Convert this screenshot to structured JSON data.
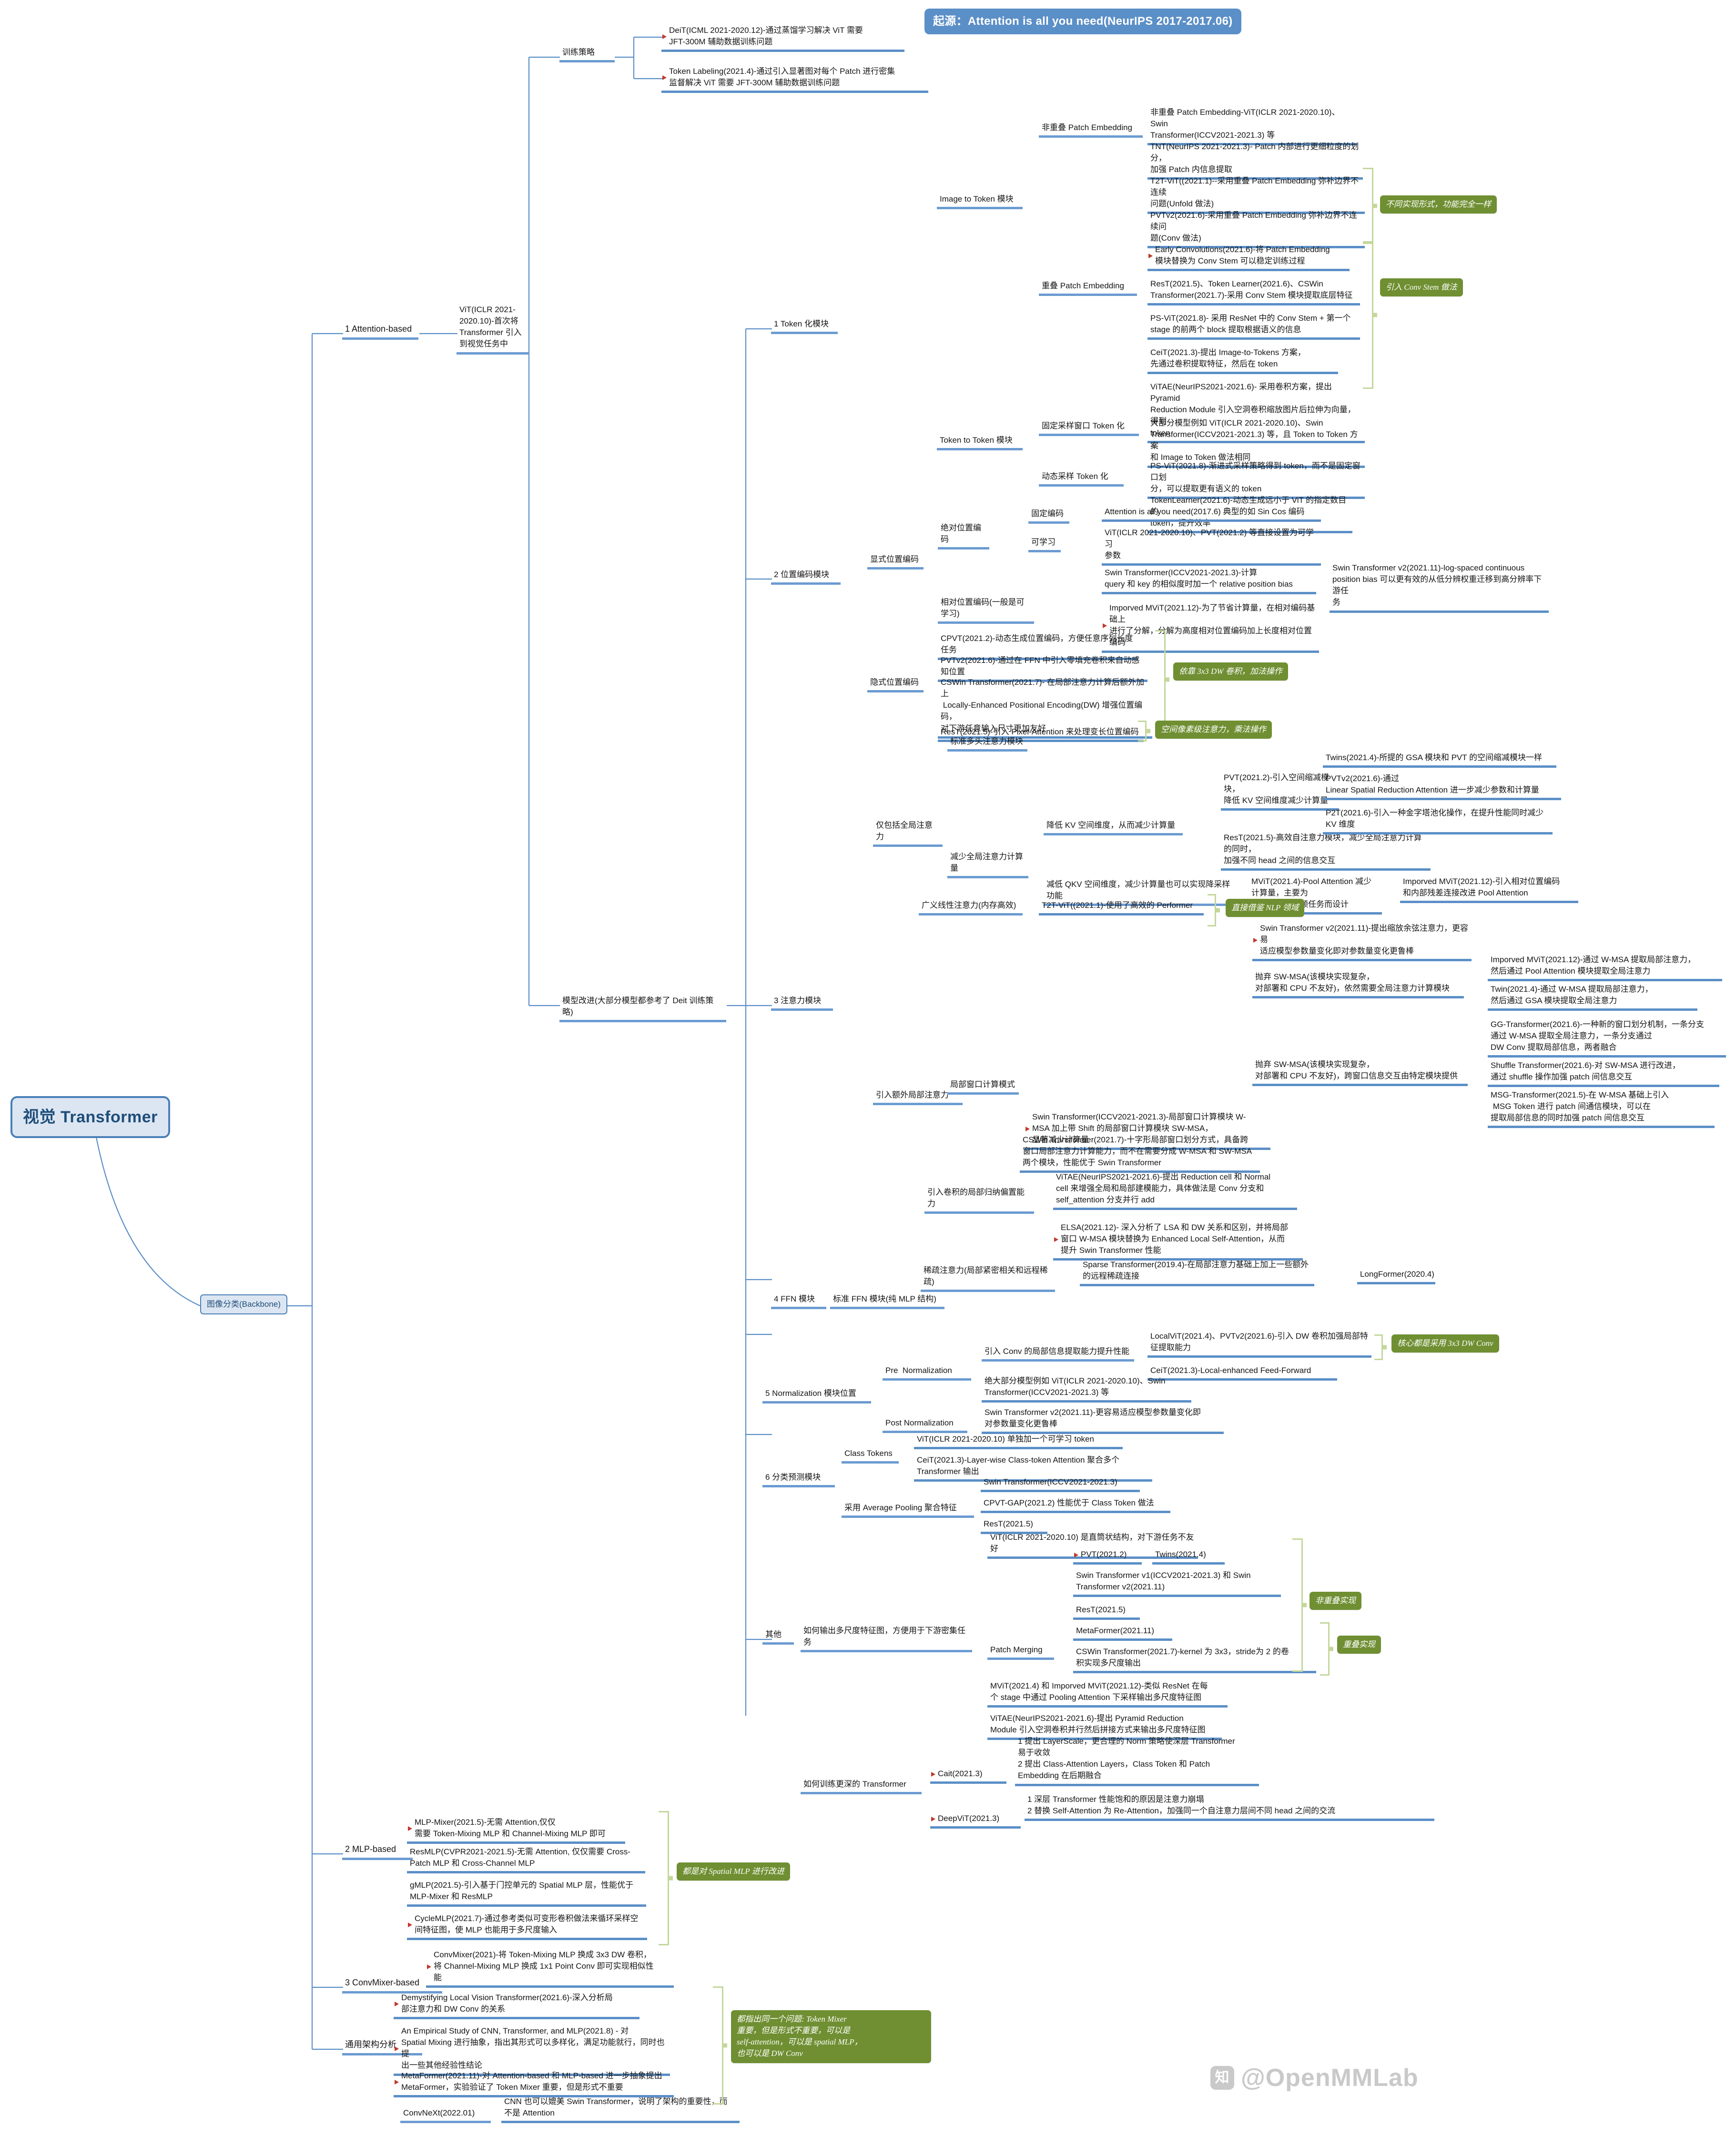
{
  "root": {
    "label": "视觉 Transformer"
  },
  "banner": {
    "label": "起源：Attention is all you need(NeurIPS 2017-2017.06)"
  },
  "watermark": {
    "label": "@OpenMMLab",
    "logo": "知"
  },
  "branches": {
    "attention_based": "1 Attention-based",
    "mlp_based": "2 MLP-based",
    "convmixer_based": "3 ConvMixer-based",
    "general_arch": "通用架构分析",
    "backbone_pill": "图像分类(Backbone)"
  },
  "attention": {
    "vit_origin": "ViT(ICLR 2021-2020.10)-首次将\nTransformer 引入\n到视觉任务中",
    "training_strategy": "训练策略",
    "training_items": [
      "DeiT(ICML 2021-2020.12)-通过蒸馏学习解决 ViT 需要\nJFT-300M 辅助数据训练问题",
      "Token Labeling(2021.4)-通过引入显著图对每个 Patch 进行密集\n监督解决 ViT 需要 JFT-300M 辅助数据训练问题"
    ],
    "model_improve": "模型改进(大部分模型都参考了 Deit 训练策略)"
  },
  "module1": {
    "label": "1 Token 化模块",
    "image_to_token": "Image to Token 模块",
    "token_to_token": "Token to Token 模块",
    "non_overlap": "非重叠 Patch Embedding",
    "overlap": "重叠 Patch Embedding",
    "non_overlap_items": [
      "非重叠 Patch Embedding-ViT(ICLR 2021-2020.10)、Swin\nTransformer(ICCV2021-2021.3) 等",
      "TNT(NeurIPS 2021-2021.3)- Patch 内部进行更细粒度的划分，\n加强 Patch 内信息提取"
    ],
    "overlap_items": [
      "T2T-ViT((2021.1)--采用重叠 Patch Embedding 弥补边界不连续\n问题(Unfold 做法)",
      "PVTv2(2021.6)-采用重叠 Patch Embedding 弥补边界不连续问\n题(Conv 做法)",
      "Early Convolutions(2021.6)-将 Patch Embedding\n模块替换为 Conv Stem 可以稳定训练过程",
      "ResT(2021.5)、Token Learner(2021.6)、CSWin\nTransformer(2021.7)-采用 Conv Stem 模块提取底层特征",
      "PS-ViT(2021.8)- 采用 ResNet 中的 Conv Stem + 第一个\nstage 的前两个 block 提取根据语义的信息",
      "CeiT(2021.3)-提出 Image-to-Tokens 方案，\n先通过卷积提取特征，然后在 token",
      "ViTAE(NeurIPS2021-2021.6)- 采用卷积方案，提出 Pyramid\nReduction Module 引入空洞卷积缩放图片后拉伸为向量，得到\ntoken"
    ],
    "fixed_window": "固定采样窗口 Token 化",
    "dynamic_sample": "动态采样 Token 化",
    "fixed_window_items": [
      "大部分模型例如 ViT(ICLR 2021-2020.10)、Swin\nTransformer(ICCV2021-2021.3) 等，且 Token to Token 方案\n和 Image to Token 做法相同"
    ],
    "dynamic_items": [
      "PS-ViT(2021.8)-渐进式采样策略得到 token，而不是固定窗口划\n分，可以提取更有语义的 token",
      "TokenLearner(2021.6)-动态生成远小于 ViT 的指定数目的\ntoken，提升效率"
    ],
    "callouts": [
      "不同实现形式，功能完全一样",
      "引入 Conv Stem 做法"
    ]
  },
  "module2": {
    "label": "2 位置编码模块",
    "explicit": "显式位置编码",
    "implicit": "隐式位置编码",
    "absolute": "绝对位置编码",
    "relative": "相对位置编码(一般是可学习)",
    "fixed_encoding": "固定编码",
    "learnable": "可学习",
    "fixed_items": [
      "Attention is all you need(2017.6) 典型的如 Sin Cos 编码"
    ],
    "learnable_items": [
      "ViT(ICLR 2021-2020.10)、PVT(2021.2) 等直接设置为可学习\n参数"
    ],
    "relative_items": [
      "Swin Transformer(ICCV2021-2021.3)-计算\nquery 和 key 的相似度时加一个 relative position bias",
      "Imporved MViT(2021.12)-为了节省计算量，在相对编码基础上\n进行了分解，分解为高度相对位置编码加上长度相对位置编码"
    ],
    "relative_sub": "Swin Transformer v2(2021.11)-log-spaced continuous\nposition bias 可以更有效的从低分辨权重迁移到高分辨率下游任\n务",
    "implicit_items": [
      "CPVT(2021.2)-动态生成位置编码，方便任意序列长度任务",
      "PVTv2(2021.6)-通过在 FFN 中引入零填充卷积来自动感知位置",
      "CSWin Transformer(2021.7)- 在局部注意力计算后额外加上\n Locally-Enhanced Positional Encoding(DW) 增强位置编码，\n对下游任意输入尺寸更加友好",
      "ResT(2021.5)-引入 Pixel-Attention 来处理变长位置编码"
    ],
    "callouts": [
      "依靠 3x3 DW 卷积，加法操作",
      "空间像素级注意力，乘法操作"
    ]
  },
  "module3": {
    "label": "3 注意力模块",
    "global_only": "仅包括全局注意力",
    "standard_mhsa": "标准多头注意力模块",
    "reduce_global": "减少全局注意力计算量",
    "reduce_kv": "降低 KV 空间维度，从而减少计算量",
    "reduce_qkv": "减低 QKV 空间维度，减少计算量也可以实现降采样功能",
    "linear_attention": "广义线性注意力(内存高效)",
    "reduce_kv_items": [
      "PVT(2021.2)-引入空间缩减模块，\n降低 KV 空间维度减少计算量",
      "ResT(2021.5)-高效自注意力模块，减少全局注意力计算的同时，\n加强不同 head 之间的信息交互"
    ],
    "reduce_kv_sub": [
      "Twins(2021.4)-所提的 GSA 模块和 PVT 的空间缩减模块一样",
      "PVTv2(2021.6)-通过\nLinear Spatial Reduction Attention 进一步减少参数和计算量",
      "P2T(2021.6)-引入一种金字塔池化操作，在提升性能同时减少\nKV 维度"
    ],
    "reduce_qkv_items": [
      "MViT(2021.4)-Pool Attention 减少计算量，主要为\n图像分类和视频任务而设计",
      "Imporved MViT(2021.12)-引入相对位置编码\n和内部残差连接改进 Pool Attention"
    ],
    "linear_items": [
      "T2T-ViT((2021.1)-使用了高效的 Performer"
    ],
    "local_window": "引入额外局部注意力",
    "local_window_mode": "局部窗口计算模式",
    "swin_main": "Swin Transformer(ICCV2021-2021.3)-局部窗口计算模块 W-\nMSA 加上带 Shift 的局部窗口计算模块 SW-MSA，\n显著减少计算量",
    "swin_v2": "Swin Transformer v2(2021.11)-提出缩放余弦注意力，更容易\n适应模型参数量变化即对参数量变化更鲁棒",
    "drop_swmsa_1": "抛弃 SW-MSA(该模块实现复杂，\n对部署和 CPU 不友好)，依然需要全局注意力计算模块",
    "drop_swmsa_2": "抛弃 SW-MSA(该模块实现复杂，\n对部署和 CPU 不友好)，跨窗口信息交互由特定模块提供",
    "drop1_items": [
      "Imporved MViT(2021.12)-通过 W-MSA 提取局部注意力，\n然后通过 Pool Attention 模块提取全局注意力",
      "Twin(2021.4)-通过 W-MSA 提取局部注意力，\n然后通过 GSA 模块提取全局注意力"
    ],
    "drop2_items": [
      "GG-Transformer(2021.6)-一种新的窗口划分机制，一条分支\n通过 W-MSA 提取全局注意力，一条分支通过\nDW Conv 提取局部信息，两者融合",
      "Shuffle Transformer(2021.6)-对 SW-MSA 进行改进，\n通过 shuffle 操作加强 patch 间信息交互",
      "MSG-Transformer(2021.5)-在 W-MSA 基础上引入\n MSG Token 进行 patch 间通信模块，可以在\n提取局部信息的同时加强 patch 间信息交互"
    ],
    "cswin_item": "CSWin Transformer(2021.7)-十字形局部窗口划分方式，具备跨\n窗口局部注意力计算能力，而不在需要分成 W-MSA 和 SW-MSA\n两个模块，性能优于 Swin Transformer",
    "conv_bias": "引入卷积的局部归纳偏置能力",
    "conv_bias_items": [
      "ViTAE(NeurIPS2021-2021.6)-提出 Reduction cell 和 Normal\ncell 来增强全局和局部建模能力，具体做法是 Conv 分支和\nself_attention 分支并行 add",
      "ELSA(2021.12)- 深入分析了 LSA 和 DW 关系和区别，并将局部\n窗口 W-MSA 模块替换为 Enhanced Local Self-Attention，从而\n提升 Swin Transformer 性能"
    ],
    "sparse": "稀疏注意力(局部紧密相关和远程稀疏)",
    "sparse_items": [
      "Sparse Transformer(2019.4)-在局部注意力基础上加上一些额外\n的远程稀疏连接",
      "LongFormer(2020.4)"
    ],
    "callouts": [
      "直接借鉴 NLP 领域"
    ]
  },
  "module4": {
    "label": "4 FFN 模块",
    "standard": "标准 FFN 模块(纯 MLP 结构)"
  },
  "module5": {
    "label": "5 Normalization 模块位置",
    "pre_norm": "Pre  Normalization",
    "post_norm": "Post Normalization",
    "conv_local": "引入 Conv 的局部信息提取能力提升性能",
    "conv_local_items": [
      "LocalViT(2021.4)、PVTv2(2021.6)-引入 DW 卷积加强局部特\n征提取能力",
      "CeiT(2021.3)-Local-enhanced Feed-Forward"
    ],
    "pre_norm_items": [
      "绝大部分模型例如 ViT(ICLR 2021-2020.10)、Swin\nTransformer(ICCV2021-2021.3) 等"
    ],
    "post_norm_items": [
      "Swin Transformer v2(2021.11)-更容易适应模型参数量变化即\n对参数量变化更鲁棒"
    ],
    "callouts": [
      "核心都是采用 3x3 DW Conv"
    ]
  },
  "module6": {
    "label": "6 分类预测模块",
    "class_tokens": "Class Tokens",
    "avg_pooling": "采用 Average Pooling 聚合特征",
    "class_token_items": [
      "ViT(ICLR 2021-2020.10) 单独加一个可学习 token",
      "CeiT(2021.3)-Layer-wise Class-token Attention 聚合多个\nTransformer 输出"
    ],
    "avg_pooling_items": [
      "Swin Transformer(ICCV2021-2021.3)",
      "CPVT-GAP(2021.2) 性能优于 Class Token 做法",
      "ResT(2021.5)"
    ]
  },
  "others": {
    "label": "其他",
    "multiscale": "如何输出多尺度特征图，方便用于下游密集任务",
    "multiscale_head": "ViT(ICLR 2021-2020.10) 是直筒状结构，对下游任务不友好",
    "patch_merging": "Patch Merging",
    "patch_merging_items": [
      "PVT(2021.2)",
      "Twins(2021.4)",
      "Swin Transformer v1(ICCV2021-2021.3) 和 Swin\nTransformer v2(2021.11)",
      "ResT(2021.5)",
      "MetaFormer(2021.11)",
      "CSWin Transformer(2021.7)-kernel 为 3x3，stride为 2 的卷\n积实现多尺度输出"
    ],
    "multiscale_items": [
      "MViT(2021.4) 和 Imporved MViT(2021.12)-类似 ResNet 在每\n个 stage 中通过 Pooling Attention 下采样输出多尺度特征图",
      "ViTAE(NeurIPS2021-2021.6)-提出 Pyramid Reduction\nModule 引入空洞卷积并行然后拼接方式来输出多尺度特征图"
    ],
    "deeper": "如何训练更深的 Transformer",
    "cait": "Cait(2021.3)",
    "cait_text": "1 提出 LayerScale，更合理的 Norm 策略使深层 Transformer\n易于收敛\n2 提出 Class-Attention Layers，Class Token 和 Patch\nEmbedding 在后期融合",
    "deepvit": "DeepViT(2021.3)",
    "deepvit_text": "1 深层 Transformer 性能饱和的原因是注意力崩塌\n2 替换 Self-Attention 为 Re-Attention，加强同一个自注意力层间不同 head 之间的交流",
    "callouts": [
      "非重叠实现",
      "重叠实现"
    ]
  },
  "mlp_based": {
    "items": [
      "MLP-Mixer(2021.5)-无需 Attention,仅仅\n需要 Token-Mixing MLP 和 Channel-Mixing MLP 即可",
      "ResMLP(CVPR2021-2021.5)-无需 Attention, 仅仅需要 Cross-\nPatch MLP 和 Cross-Channel MLP",
      "gMLP(2021.5)-引入基于门控单元的 Spatial MLP 层，性能优于\nMLP-Mixer 和 ResMLP",
      "CycleMLP(2021.7)-通过参考类似可变形卷积做法来循环采样空\n间特征图，使 MLP 也能用于多尺度输入"
    ],
    "callouts": [
      "都是对 Spatial MLP 进行改进"
    ]
  },
  "convmixer": {
    "items": [
      "ConvMixer(2021)-将 Token-Mixing MLP 换成 3x3 DW 卷积，\n将 Channel-Mixing MLP 换成 1x1 Point Conv 即可实现相似性\n能"
    ]
  },
  "general_arch": {
    "items": [
      "Demystifying Local Vision Transformer(2021.6)-深入分析局\n部注意力和 DW Conv 的关系",
      "An Empirical Study of CNN, Transformer, and MLP(2021.8) - 对\nSpatial Mixing 进行抽象，指出其形式可以多样化，满足功能就行，同时也提\n出一些其他经验性结论",
      "MetaFormer(2021.11)-对 Attention-based 和 MLP-based 进一步抽象提出\nMetaFormer，实验验证了 Token Mixer 重要，但是形式不重要",
      "CNN 也可以媲美 Swin Transformer，说明了架构的重要性，而\n不是 Attention"
    ],
    "convnext": "ConvNeXt(2022.01)",
    "callouts": [
      "都指出同一个问题: Token Mixer\n重要，但是形式不重要，可以是\nself-attention，可以是 spatial MLP，\n也可以是 DW Conv"
    ]
  }
}
